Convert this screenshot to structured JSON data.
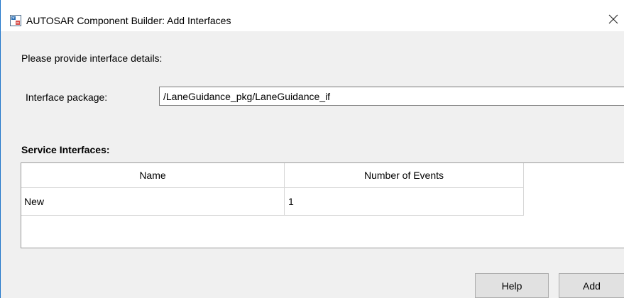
{
  "window": {
    "title": "AUTOSAR Component Builder: Add Interfaces",
    "close_symbol": "×"
  },
  "form": {
    "prompt": "Please provide interface details:",
    "package_label": "Interface package:",
    "package_value": "/LaneGuidance_pkg/LaneGuidance_if"
  },
  "service_interfaces": {
    "title": "Service Interfaces:",
    "columns": [
      "Name",
      "Number of Events"
    ],
    "rows": [
      [
        "New",
        "1"
      ]
    ]
  },
  "buttons": {
    "help": "Help",
    "add": "Add"
  },
  "icons": {
    "app": "simulink-model-icon",
    "close": "close-icon"
  },
  "colors": {
    "window_border": "#1d74c9",
    "background": "#f0f0f0",
    "button_face": "#e1e1e1"
  }
}
